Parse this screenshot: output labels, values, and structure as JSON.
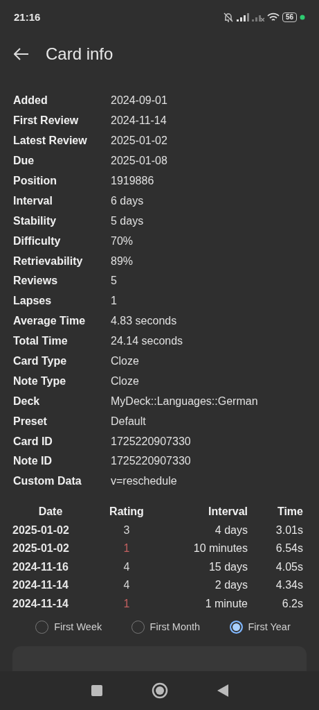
{
  "status_bar": {
    "time": "21:16",
    "battery": "56"
  },
  "app_bar": {
    "title": "Card info"
  },
  "info": [
    {
      "label": "Added",
      "value": "2024-09-01"
    },
    {
      "label": "First Review",
      "value": "2024-11-14"
    },
    {
      "label": "Latest Review",
      "value": "2025-01-02"
    },
    {
      "label": "Due",
      "value": "2025-01-08"
    },
    {
      "label": "Position",
      "value": "1919886"
    },
    {
      "label": "Interval",
      "value": "6 days"
    },
    {
      "label": "Stability",
      "value": "5 days"
    },
    {
      "label": "Difficulty",
      "value": "70%"
    },
    {
      "label": "Retrievability",
      "value": "89%"
    },
    {
      "label": "Reviews",
      "value": "5"
    },
    {
      "label": "Lapses",
      "value": "1"
    },
    {
      "label": "Average Time",
      "value": "4.83 seconds"
    },
    {
      "label": "Total Time",
      "value": "24.14 seconds"
    },
    {
      "label": "Card Type",
      "value": "Cloze"
    },
    {
      "label": "Note Type",
      "value": "Cloze"
    },
    {
      "label": "Deck",
      "value": "MyDeck::Languages::German"
    },
    {
      "label": "Preset",
      "value": "Default"
    },
    {
      "label": "Card ID",
      "value": "1725220907330"
    },
    {
      "label": "Note ID",
      "value": "1725220907330"
    },
    {
      "label": "Custom Data",
      "value": "v=reschedule"
    }
  ],
  "reviews": {
    "columns": [
      "Date",
      "Rating",
      "Interval",
      "Time"
    ],
    "rows": [
      {
        "date": "2025-01-02",
        "rating": "3",
        "color": "#d6d6d6",
        "interval": "4 days",
        "time": "3.01s"
      },
      {
        "date": "2025-01-02",
        "rating": "1",
        "color": "#c26060",
        "interval": "10 minutes",
        "time": "6.54s"
      },
      {
        "date": "2024-11-16",
        "rating": "4",
        "color": "#d6d6d6",
        "interval": "15 days",
        "time": "4.05s"
      },
      {
        "date": "2024-11-14",
        "rating": "4",
        "color": "#d6d6d6",
        "interval": "2 days",
        "time": "4.34s"
      },
      {
        "date": "2024-11-14",
        "rating": "1",
        "color": "#c26060",
        "interval": "1 minute",
        "time": "6.2s"
      }
    ]
  },
  "range_options": [
    {
      "label": "First Week",
      "selected": false
    },
    {
      "label": "First Month",
      "selected": false
    },
    {
      "label": "First Year",
      "selected": true
    }
  ]
}
